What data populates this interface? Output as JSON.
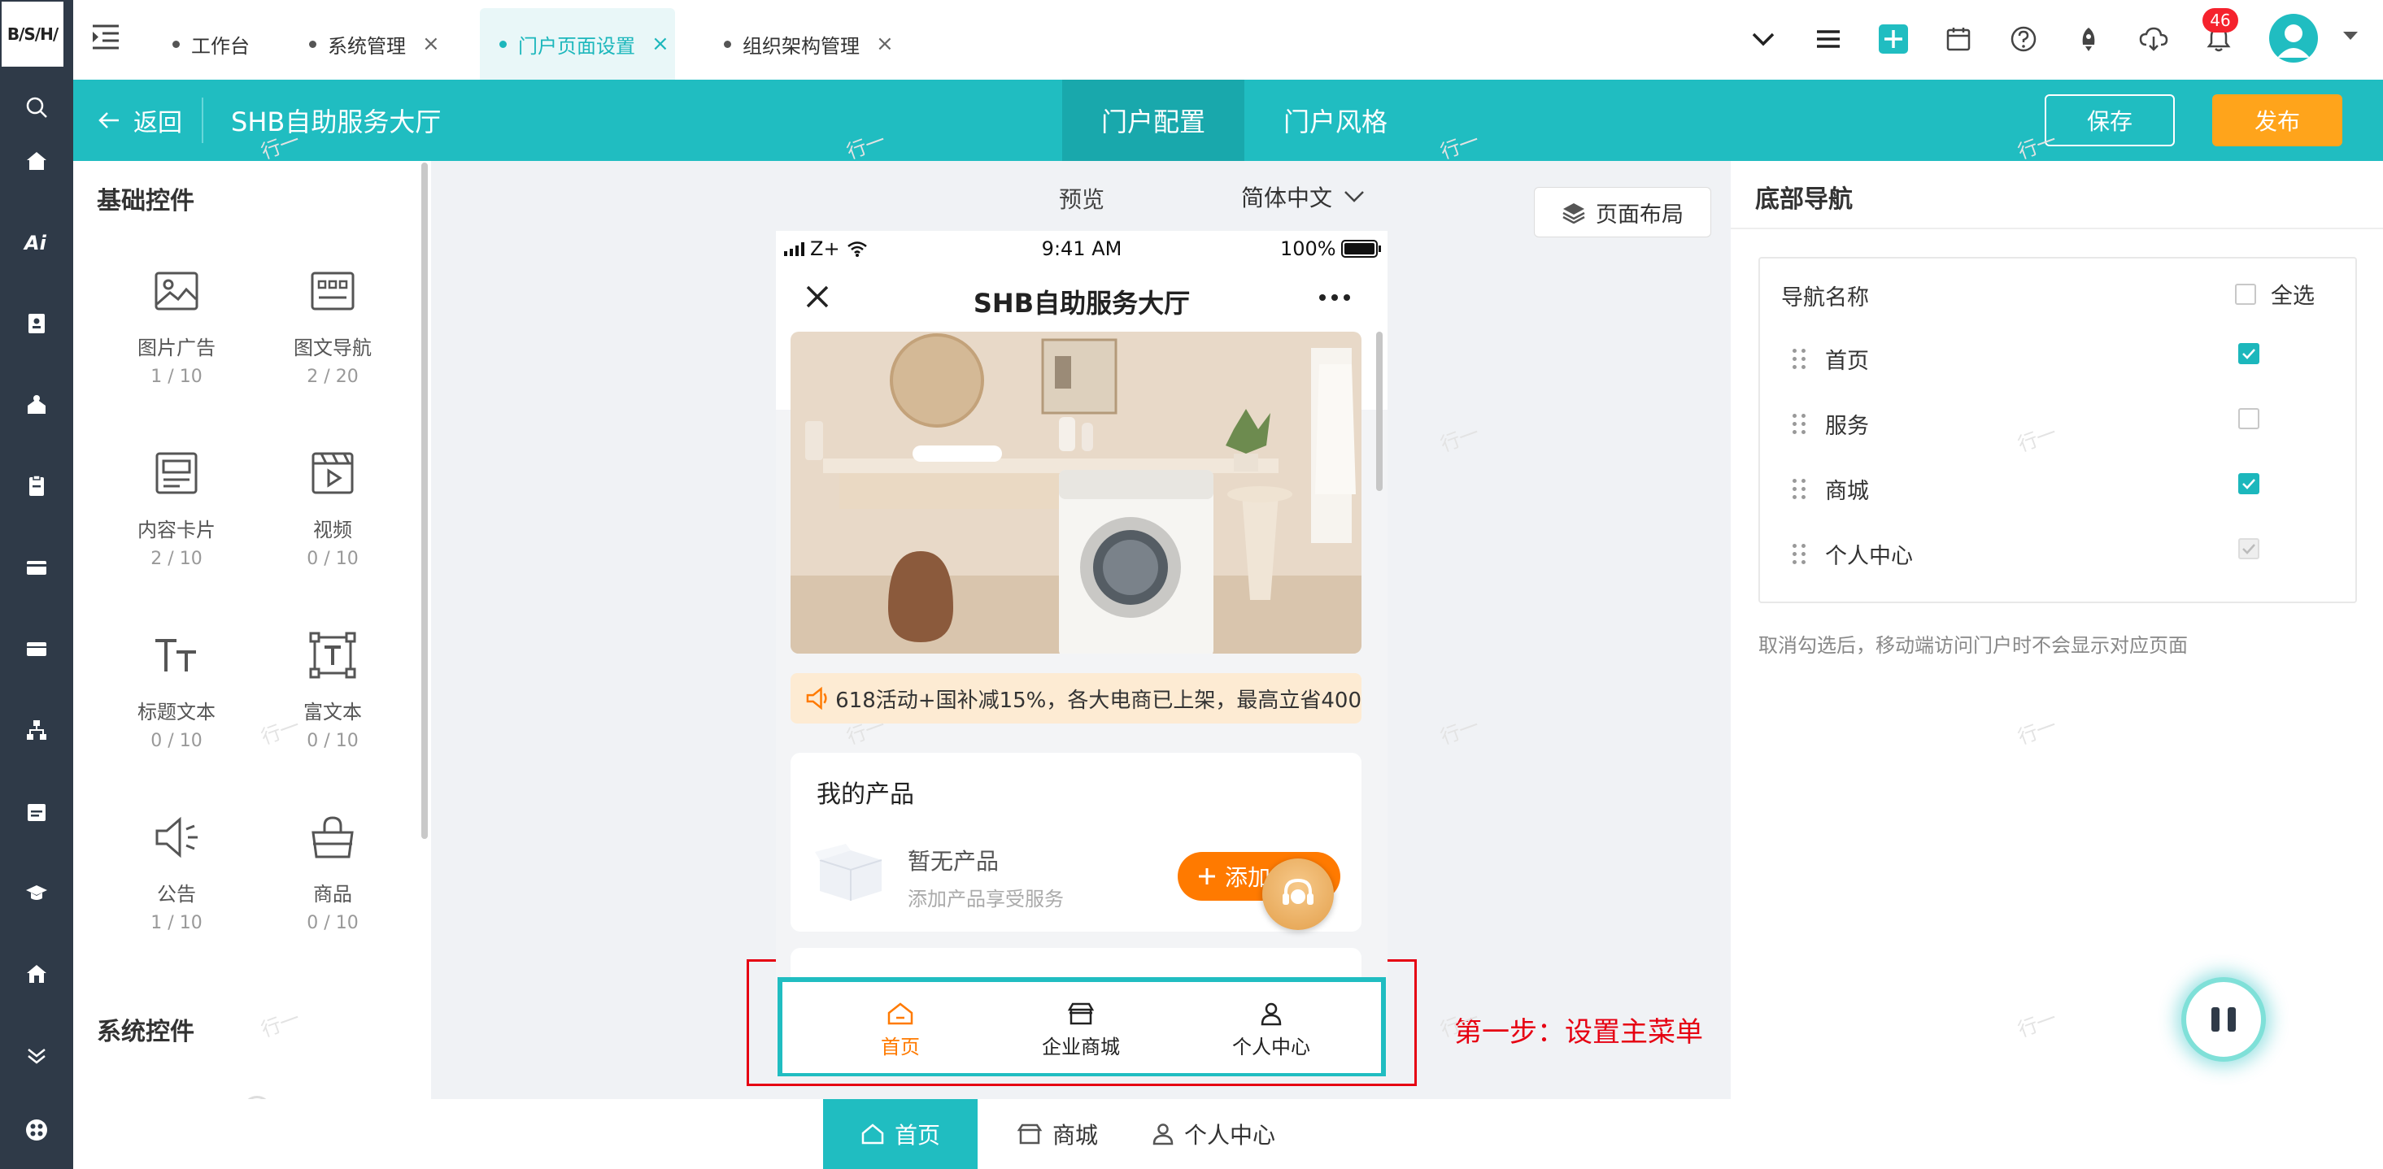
{
  "logo_text": "B/S/H/",
  "tabs": [
    {
      "label": "工作台",
      "closable": false
    },
    {
      "label": "系统管理",
      "closable": true
    },
    {
      "label": "门户页面设置",
      "closable": true,
      "active": true
    },
    {
      "label": "组织架构管理",
      "closable": true
    }
  ],
  "close_glyph": "×",
  "notification_count": "46",
  "header": {
    "back_label": "返回",
    "site_title": "SHB自助服务大厅",
    "center_tabs": [
      "门户配置",
      "门户风格"
    ],
    "save_label": "保存",
    "publish_label": "发布"
  },
  "left_panel": {
    "basic_title": "基础控件",
    "system_title": "系统控件",
    "widgets": [
      {
        "name": "图片广告",
        "count": "1 / 10",
        "icon": "image-icon"
      },
      {
        "name": "图文导航",
        "count": "2 / 20",
        "icon": "grid-nav-icon"
      },
      {
        "name": "内容卡片",
        "count": "2 / 10",
        "icon": "content-card-icon"
      },
      {
        "name": "视频",
        "count": "0 / 10",
        "icon": "video-icon"
      },
      {
        "name": "标题文本",
        "count": "0 / 10",
        "icon": "title-text-icon"
      },
      {
        "name": "富文本",
        "count": "0 / 10",
        "icon": "rich-text-icon"
      },
      {
        "name": "公告",
        "count": "1 / 10",
        "icon": "announcement-icon"
      },
      {
        "name": "商品",
        "count": "0 / 10",
        "icon": "product-bag-icon"
      }
    ]
  },
  "preview_bar": {
    "preview_label": "预览",
    "language": "简体中文",
    "layout_button": "页面布局"
  },
  "phone": {
    "carrier": "Z+",
    "time": "9:41 AM",
    "battery": "100%",
    "title": "SHB自助服务大厅",
    "notice": "618活动+国补减15%，各大电商已上架，最高立省400",
    "products_title": "我的产品",
    "no_product": "暂无产品",
    "no_product_sub": "添加产品享受服务",
    "add_button": "添加",
    "bottom_nav": [
      {
        "label": "首页",
        "active": true,
        "icon": "home-icon"
      },
      {
        "label": "企业商城",
        "active": false,
        "icon": "shop-icon"
      },
      {
        "label": "个人中心",
        "active": false,
        "icon": "user-icon"
      }
    ]
  },
  "annotation": "第一步：设置主菜单",
  "right_panel": {
    "title": "底部导航",
    "column_label": "导航名称",
    "select_all": "全选",
    "items": [
      {
        "label": "首页",
        "checked": true
      },
      {
        "label": "服务",
        "checked": false
      },
      {
        "label": "商城",
        "checked": true
      },
      {
        "label": "个人中心",
        "checked": true,
        "disabled": true
      }
    ],
    "hint": "取消勾选后，移动端访问门户时不会显示对应页面"
  },
  "bottom_bar": [
    {
      "label": "首页",
      "active": true
    },
    {
      "label": "商城",
      "active": false
    },
    {
      "label": "个人中心",
      "active": false
    }
  ],
  "watermark": "行一",
  "colors": {
    "teal": "#20bdc1",
    "orange": "#ff7a00",
    "publish": "#ffa41b",
    "red_annotation": "#e60012"
  }
}
